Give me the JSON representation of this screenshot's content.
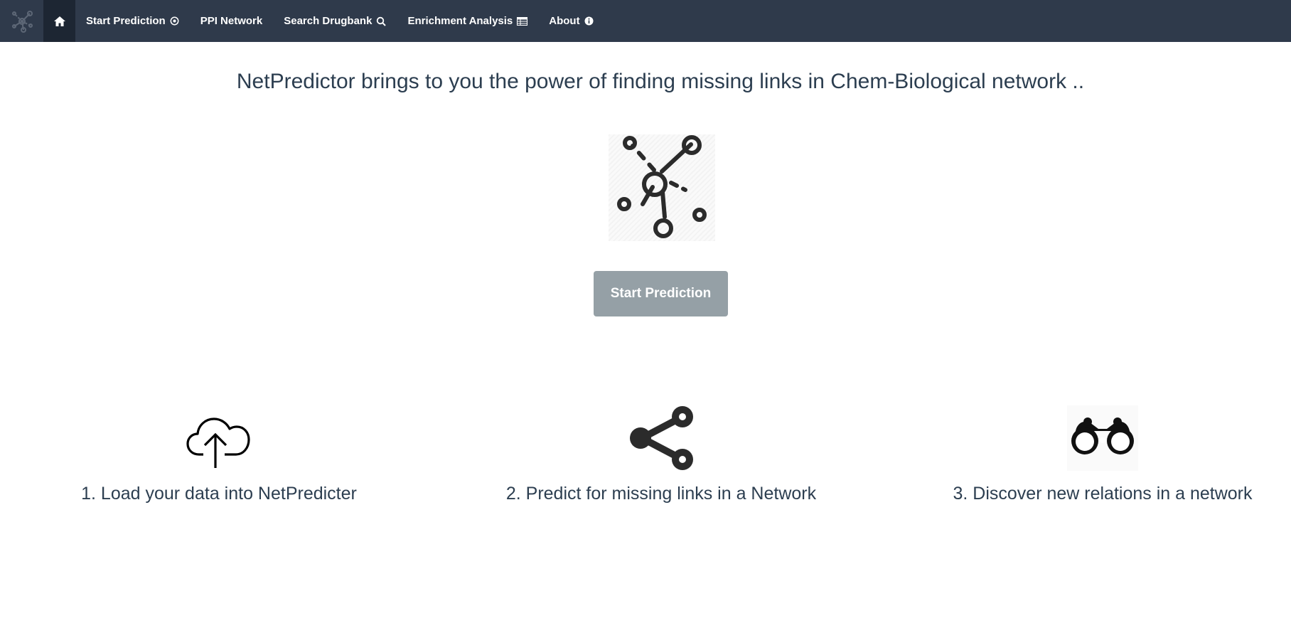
{
  "navbar": {
    "brand_icon": "network-logo-icon",
    "home_icon": "home-icon",
    "items": [
      {
        "label": "Start Prediction",
        "icon": "target-icon"
      },
      {
        "label": "PPI Network",
        "icon": ""
      },
      {
        "label": "Search Drugbank",
        "icon": "search-icon"
      },
      {
        "label": "Enrichment Analysis",
        "icon": "table-icon"
      },
      {
        "label": "About",
        "icon": "info-icon"
      }
    ],
    "background": "#2f3a4b",
    "active_background": "#1d2633"
  },
  "main": {
    "headline": "NetPredictor brings to you the power of finding missing links in Chem-Biological network ..",
    "hero_icon": "network-graph-icon",
    "start_button_label": "Start Prediction",
    "start_button_color": "#95a0a6"
  },
  "steps": [
    {
      "label": "1. Load your data into NetPredicter",
      "icon": "cloud-upload-icon"
    },
    {
      "label": "2. Predict for missing links in a Network",
      "icon": "share-icon"
    },
    {
      "label": "3. Discover new relations in a network",
      "icon": "binoculars-icon"
    }
  ]
}
